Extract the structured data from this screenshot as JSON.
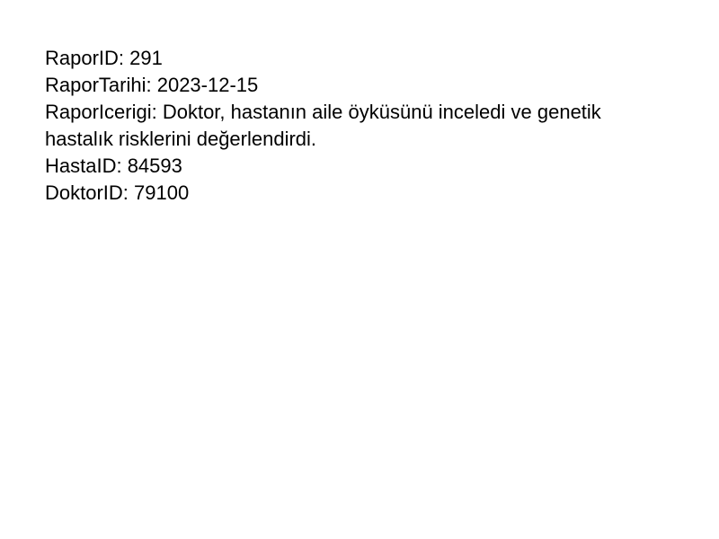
{
  "report": {
    "rapor_id": "RaporID: 291",
    "rapor_tarihi": "RaporTarihi: 2023-12-15",
    "rapor_icerigi": "RaporIcerigi: Doktor, hastanın aile öyküsünü inceledi ve genetik hastalık risklerini değerlendirdi.",
    "hasta_id": "HastaID: 84593",
    "doktor_id": "DoktorID: 79100"
  }
}
